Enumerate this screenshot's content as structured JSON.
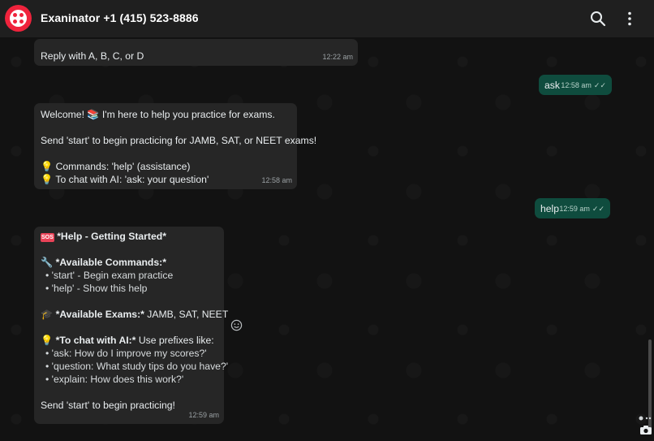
{
  "header": {
    "title": "Exaninator +1 (415) 523-8886",
    "search_icon": "search-icon",
    "menu_icon": "kebab-menu-icon",
    "logo_icon": "twilio-logo-icon"
  },
  "colors": {
    "header_bg": "#1f1f1f",
    "incoming_bubble": "#262626",
    "outgoing_bubble": "#0f4c3e",
    "logo_red": "#ef233c"
  },
  "messages": {
    "m1": {
      "text": "Reply with A, B, C, or D",
      "time": "12:22 am"
    },
    "m2": {
      "text": "ask",
      "time": "12:58 am"
    },
    "m3": {
      "line1": "Welcome! 📚 I'm here to help you practice for exams.",
      "line2": "Send 'start' to begin practicing for JAMB, SAT, or NEET exams!",
      "line3": "Commands: 'help' (assistance)",
      "line4": "To chat with AI: 'ask: your question'",
      "time": "12:58 am"
    },
    "m4": {
      "text": "help",
      "time": "12:59 am"
    },
    "m5": {
      "sos": "SOS",
      "heading": "*Help - Getting Started*",
      "commands_heading": "*Available Commands:*",
      "cmd1": "'start' - Begin exam practice",
      "cmd2": "'help' - Show this help",
      "exams_heading": "*Available Exams:*",
      "exams_list": " JAMB, SAT, NEET",
      "ai_heading": "*To chat with AI:*",
      "ai_text": " Use prefixes like:",
      "ex1": "'ask: How do I improve my scores?'",
      "ex2": "'question: What study tips do you have?'",
      "ex3": "'explain: How does this work?'",
      "footer": "Send 'start' to begin practicing!",
      "time": "12:59 am"
    }
  }
}
